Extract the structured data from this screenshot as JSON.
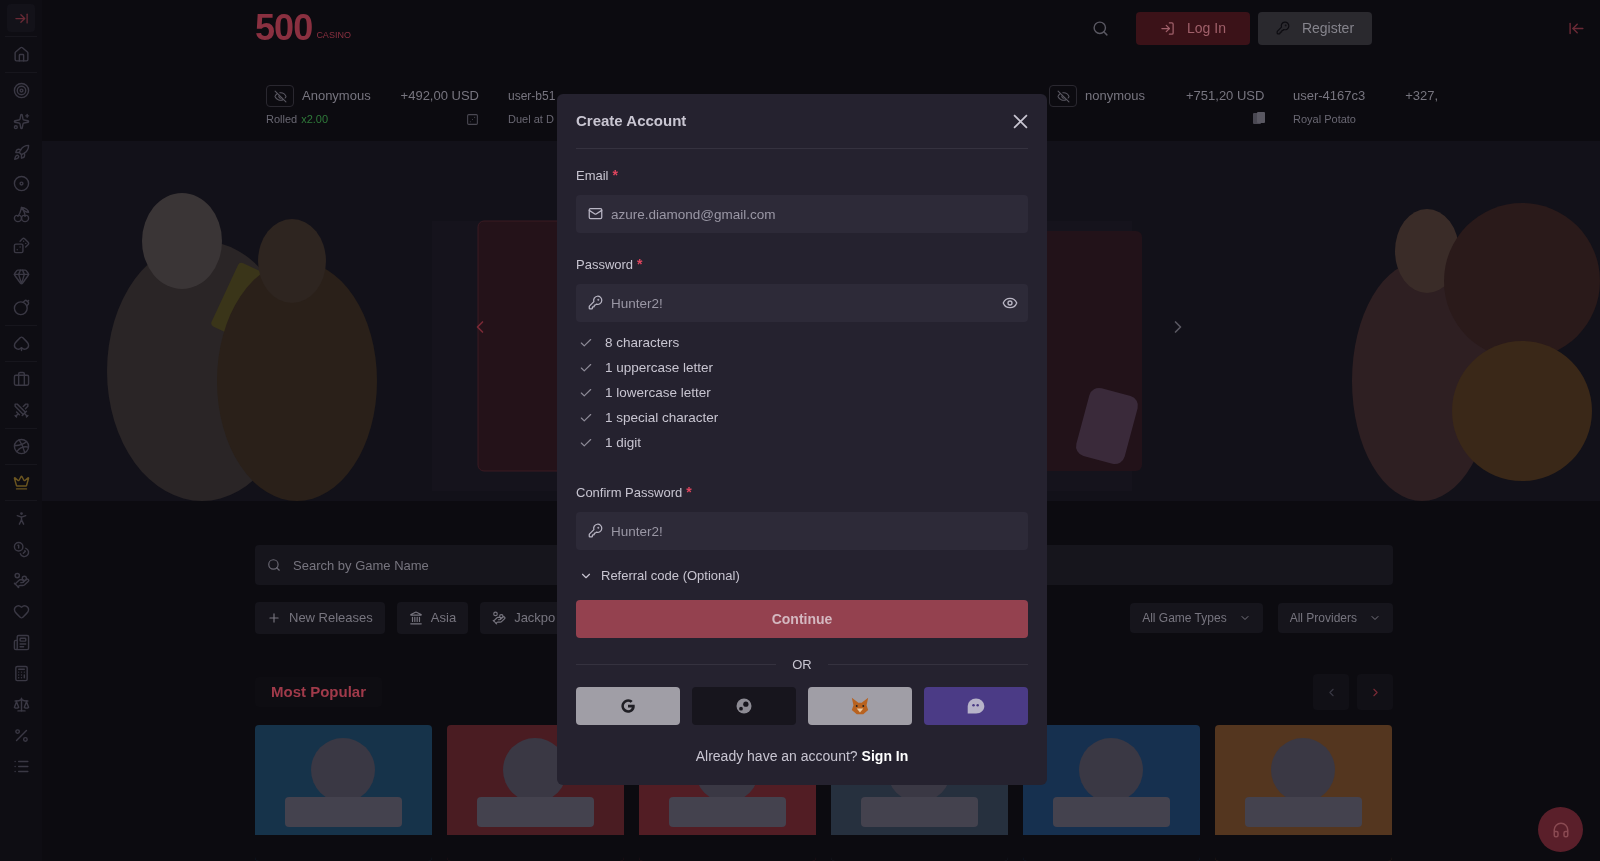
{
  "logo": {
    "text": "500",
    "sub": "CASINO"
  },
  "header": {
    "login": "Log In",
    "register": "Register"
  },
  "ticker": [
    {
      "user": "Anonymous",
      "amount": "+492,00 USD",
      "note": "Rolled",
      "multiplier": "x2.00",
      "hidden": true
    },
    {
      "user": "user-b51",
      "note": "Duel at D",
      "hidden": false
    }
  ],
  "ticker_right": [
    {
      "user": "nonymous",
      "amount": "+751,20 USD",
      "hidden": true
    },
    {
      "user": "user-4167c3",
      "amount": "+327,",
      "note": "Royal Potato",
      "hidden": false
    }
  ],
  "search": {
    "placeholder": "Search by Game Name"
  },
  "filters": [
    {
      "label": "New Releases",
      "kind": "plus"
    },
    {
      "label": "Asia",
      "kind": "temple"
    },
    {
      "label": "Jackpo",
      "kind": "hand"
    }
  ],
  "dropdowns": [
    "All Game Types",
    "All Providers"
  ],
  "section_title": "Most Popular",
  "games": [
    {
      "kind": "picture",
      "color": "#16334a"
    },
    {
      "kind": "picture",
      "color": "#4a1c22"
    },
    {
      "kind": "picture",
      "color": "#521d24"
    },
    {
      "kind": "picture",
      "color": "#26303e"
    },
    {
      "kind": "picture",
      "color": "#16304f"
    },
    {
      "kind": "picture",
      "color": "#54361f"
    }
  ],
  "modal": {
    "title": "Create Account",
    "email": {
      "label": "Email",
      "required": true,
      "marker": "*",
      "placeholder": "azure.diamond@gmail.com"
    },
    "password": {
      "label": "Password",
      "required": true,
      "marker": "*",
      "placeholder": "Hunter2!"
    },
    "rules": [
      {
        "text": "8 characters",
        "met": true
      },
      {
        "text": "1 uppercase letter",
        "met": true
      },
      {
        "text": "1 lowercase letter",
        "met": true
      },
      {
        "text": "1 special character",
        "met": true
      },
      {
        "text": "1 digit",
        "met": true
      }
    ],
    "confirm": {
      "label": "Confirm Password",
      "required": true,
      "marker": "*",
      "placeholder": "Hunter2!"
    },
    "referral": {
      "label": "Referral code (Optional)",
      "expanded": false
    },
    "continue": "Continue",
    "or": "OR",
    "socials": [
      {
        "kind": "google"
      },
      {
        "kind": "steam"
      },
      {
        "kind": "metamask"
      },
      {
        "kind": "ghost"
      }
    ],
    "footer": {
      "text": "Already have an account?",
      "link": "Sign In"
    }
  }
}
